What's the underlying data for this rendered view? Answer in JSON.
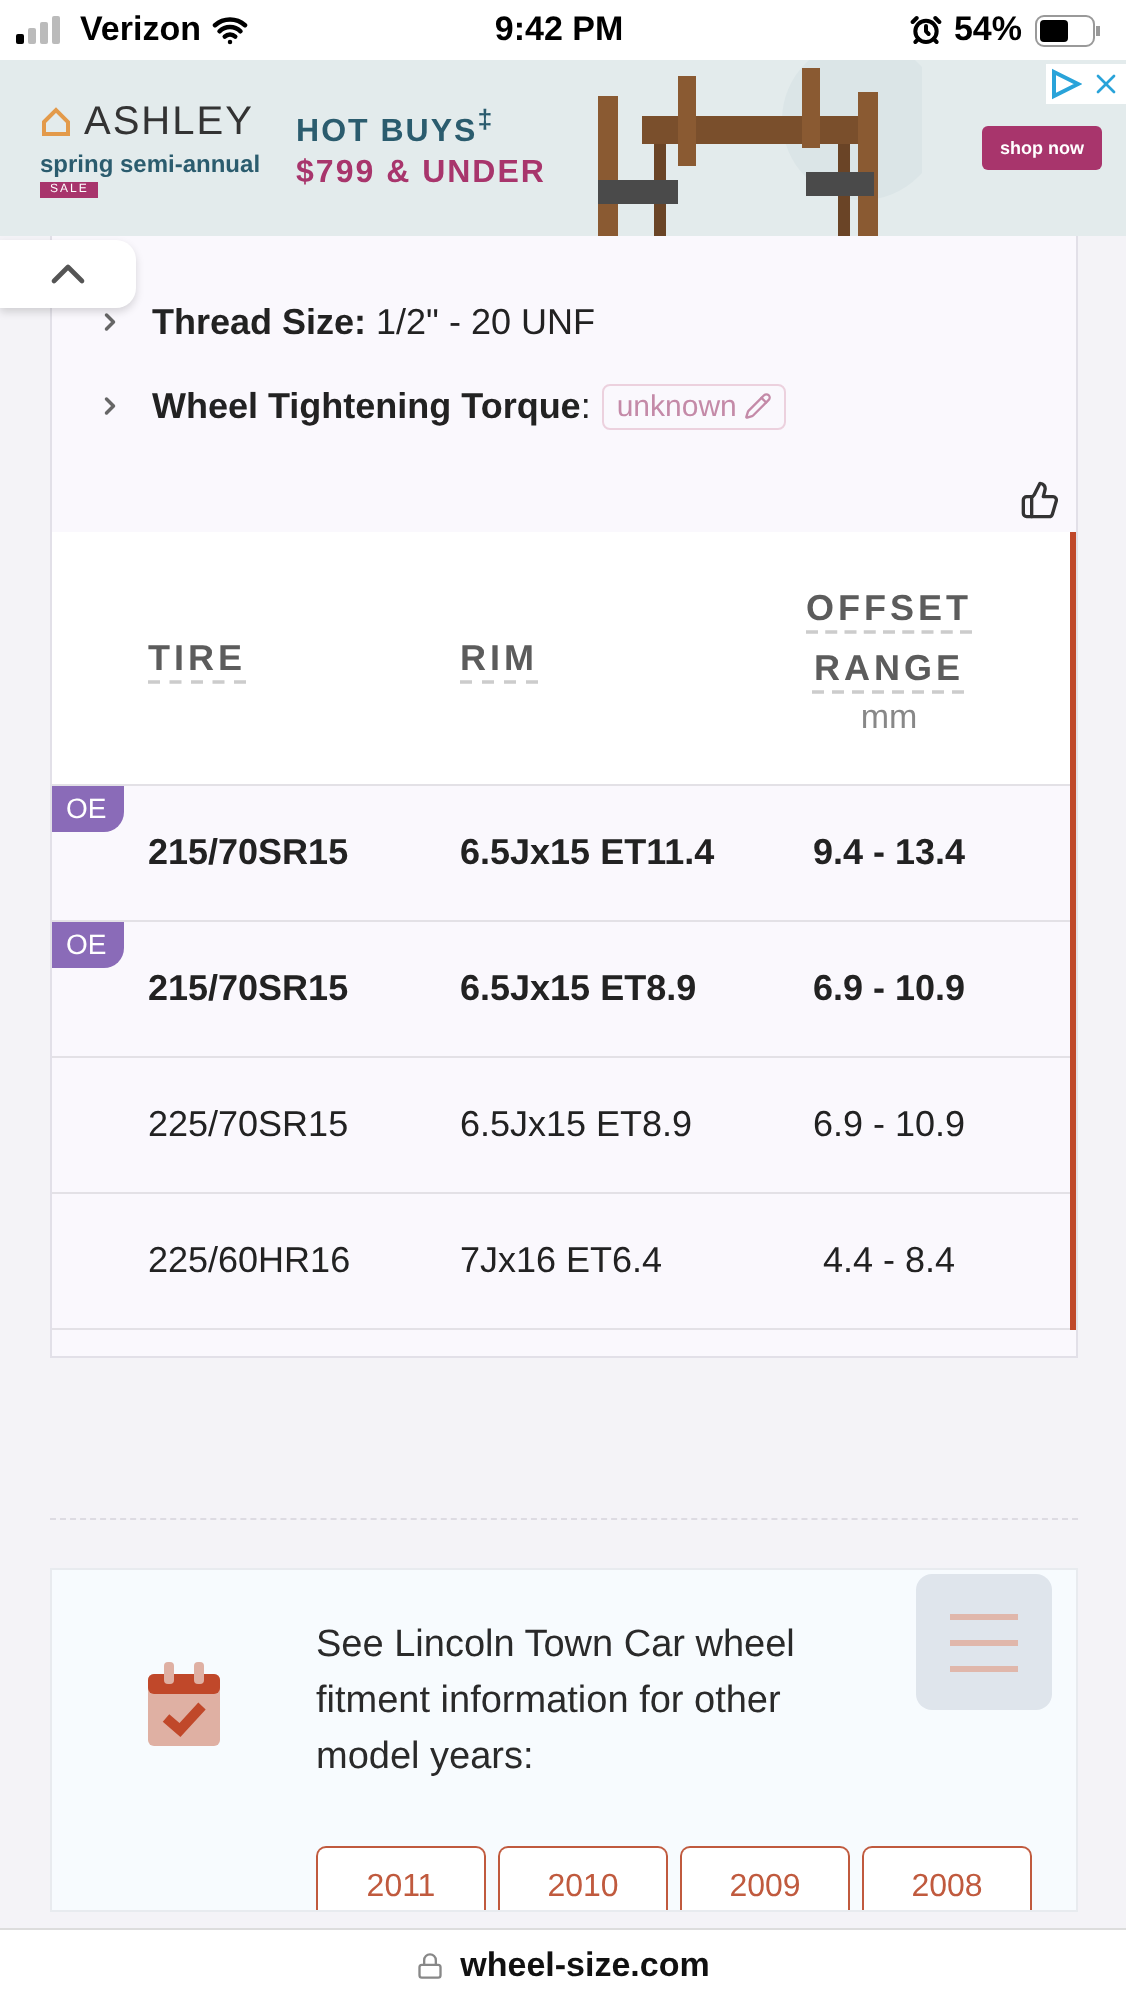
{
  "status_bar": {
    "carrier": "Verizon",
    "time": "9:42 PM",
    "battery": "54%"
  },
  "ad": {
    "brand": "ASHLEY",
    "tagline": "spring semi-annual",
    "badge": "SALE",
    "headline": "HOT BUYS$^{‡}$",
    "offer": "$799 & UNDER",
    "button": "shop now"
  },
  "specs": [
    {
      "text": "**Thread Size:** 1/2\" - 20 UNF"
    },
    {
      "text": "**Wheel Tightening Torque**:",
      "tag": "unknown"
    }
  ],
  "table": {
    "columns": [
      {
        "label": "TIRE"
      },
      {
        "label": "RIM"
      },
      {
        "label": "OFFSET RANGE",
        "unit": "mm"
      }
    ],
    "rows": [
      {
        "oe": true,
        "badge": "OE",
        "tire": "215/70SR15",
        "rim": "6.5Jx15 ET11.4",
        "offset": "9.4 - 13.4"
      },
      {
        "oe": true,
        "badge": "OE",
        "tire": "215/70SR15",
        "rim": "6.5Jx15 ET8.9",
        "offset": "6.9 - 10.9"
      },
      {
        "oe": false,
        "tire": "225/70SR15",
        "rim": "6.5Jx15 ET8.9",
        "offset": "6.9 - 10.9"
      },
      {
        "oe": false,
        "tire": "225/60HR16",
        "rim": "7Jx16 ET6.4",
        "offset": "4.4 - 8.4"
      }
    ]
  },
  "years": {
    "text": "See Lincoln Town Car wheel fitment information for other model years:",
    "items": [
      "2011",
      "2010",
      "2009",
      "2008"
    ]
  },
  "browser": {
    "url": "wheel-size.com"
  }
}
